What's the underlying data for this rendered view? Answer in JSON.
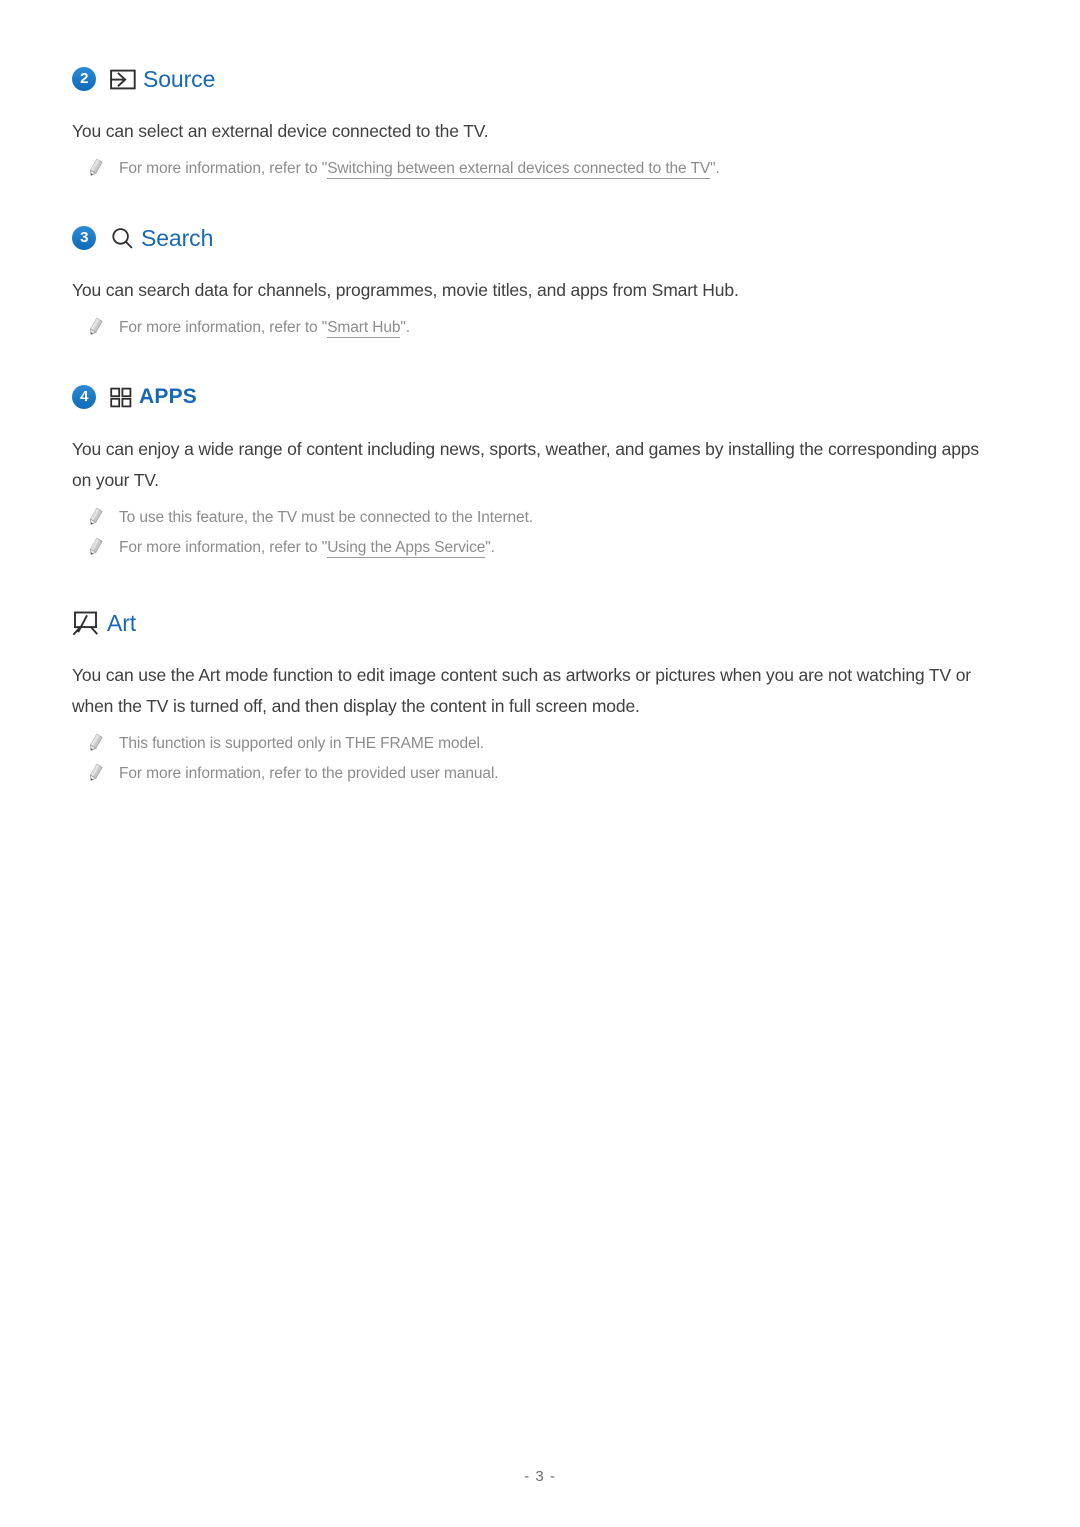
{
  "page": {
    "footer_label": "- 3 -",
    "accent_blue": "#1769b5",
    "badge_blue": "#1878c8",
    "body_text_color": "#404040",
    "note_text_color": "#8c8c8c"
  },
  "sections": [
    {
      "number": "2",
      "icon": "source-icon",
      "title": "Source",
      "paragraphs": [
        "You can select an external device connected to the TV."
      ],
      "notes": [
        {
          "prefix": "For more information, refer to \"",
          "link": "Switching between external devices connected to the TV",
          "suffix": "\"."
        }
      ]
    },
    {
      "number": "3",
      "icon": "search-icon",
      "title": "Search",
      "paragraphs": [
        "You can search data for channels, programmes, movie titles, and apps from Smart Hub."
      ],
      "notes": [
        {
          "prefix": "For more information, refer to \"",
          "link": "Smart Hub",
          "suffix": "\"."
        }
      ]
    },
    {
      "number": "4",
      "icon": "apps-grid-icon",
      "title": "APPS",
      "paragraphs": [
        "You can enjoy a wide range of content including news, sports, weather, and games by installing the corresponding apps on your TV."
      ],
      "notes": [
        {
          "prefix": "To use this feature, the TV must be connected to the Internet.",
          "link": "",
          "suffix": ""
        },
        {
          "prefix": "For more information, refer to \"",
          "link": "Using the Apps Service",
          "suffix": "\"."
        }
      ]
    },
    {
      "number": "",
      "icon": "art-frame-icon",
      "title": "Art",
      "paragraphs": [
        "You can use the Art mode function to edit image content such as artworks or pictures when you are not watching TV or when the TV is turned off, and then display the content in full screen mode."
      ],
      "notes": [
        {
          "prefix": "This function is supported only in THE FRAME model.",
          "link": "",
          "suffix": ""
        },
        {
          "prefix": "For more information, refer to the provided user manual.",
          "link": "",
          "suffix": ""
        }
      ]
    }
  ]
}
